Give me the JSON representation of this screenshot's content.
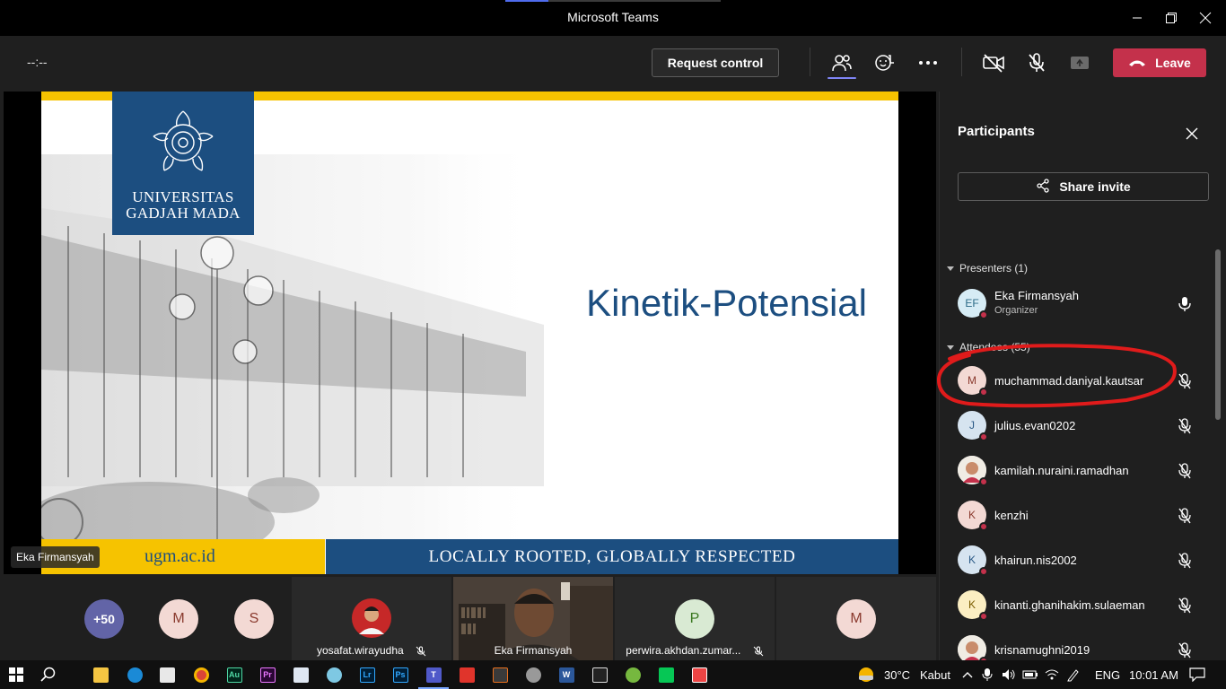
{
  "window": {
    "title": "Microsoft Teams"
  },
  "controls": {
    "timer": "--:--",
    "request_control": "Request control",
    "leave": "Leave"
  },
  "slide": {
    "university_line1": "UNIVERSITAS",
    "university_line2": "GADJAH MADA",
    "title": "Kinetik-Potensial",
    "footer_left": "ugm.ac.id",
    "footer_right": "LOCALLY ROOTED, GLOBALLY RESPECTED",
    "presenter_tag": "Eka Firmansyah",
    "colors": {
      "brand_blue": "#1c4e80",
      "brand_yellow": "#f6c300"
    }
  },
  "gallery": {
    "overflow_count": "+50",
    "avatars": [
      {
        "initial": "M",
        "bg": "#f3d9d4",
        "fg": "#8a3a2e"
      },
      {
        "initial": "S",
        "bg": "#f3d9d4",
        "fg": "#8a3a2e"
      }
    ],
    "tiles": [
      {
        "name": "yosafat.wirayudha"
      },
      {
        "name": "Eka Firmansyah"
      },
      {
        "name": "perwira.akhdan.zumar...",
        "initial": "P"
      }
    ],
    "last_avatar": {
      "initial": "M"
    }
  },
  "participants": {
    "title": "Participants",
    "share_invite": "Share invite",
    "presenters_header": "Presenters (1)",
    "presenters": [
      {
        "initials": "EF",
        "name": "Eka Firmansyah",
        "role": "Organizer"
      }
    ],
    "attendees_header": "Attendees (55)",
    "attendees": [
      {
        "initial": "M",
        "name": "muchammad.daniyal.kautsar",
        "bg": "#f3d9d4",
        "fg": "#8a3a2e"
      },
      {
        "initial": "J",
        "name": "julius.evan0202",
        "bg": "#d6e4f0",
        "fg": "#2b5a86"
      },
      {
        "initial": "",
        "name": "kamilah.nuraini.ramadhan",
        "bg": "#ffffff",
        "fg": "#c4314b",
        "photo": true
      },
      {
        "initial": "K",
        "name": "kenzhi",
        "bg": "#f3d9d4",
        "fg": "#8a3a2e"
      },
      {
        "initial": "K",
        "name": "khairun.nis2002",
        "bg": "#d6e4f0",
        "fg": "#2b5a86"
      },
      {
        "initial": "K",
        "name": "kinanti.ghanihakim.sulaeman",
        "bg": "#fbeec2",
        "fg": "#7a5c00"
      },
      {
        "initial": "",
        "name": "krisnamughni2019",
        "bg": "#e8e3d6",
        "fg": "#555",
        "photo": true
      }
    ]
  },
  "taskbar": {
    "weather_temp": "30°C",
    "weather_desc": "Kabut",
    "language": "ENG",
    "time": "10:01 AM"
  }
}
